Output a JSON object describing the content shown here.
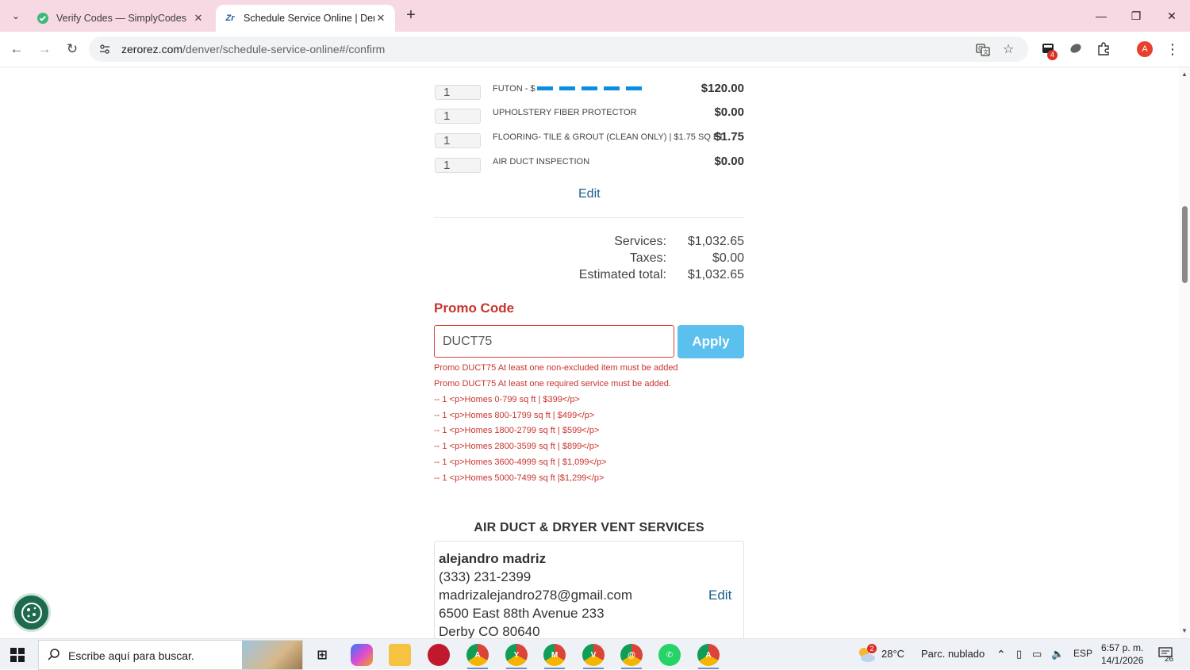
{
  "browser": {
    "tabs": [
      {
        "title": "Verify Codes — SimplyCodes",
        "favicon": "simplycodes-icon"
      },
      {
        "title": "Schedule Service Online | Denver",
        "favicon": "zerorez-icon",
        "favicon_text": "Zr"
      }
    ],
    "url_host": "zerorez.com",
    "url_path": "/denver/schedule-service-online#/confirm",
    "extension_badge": "4",
    "profile_initial": "A"
  },
  "order": {
    "items": [
      {
        "qty": "1",
        "name": "FUTON - $",
        "price": "$120.00"
      },
      {
        "qty": "1",
        "name": "UPHOLSTERY FIBER PROTECTOR",
        "price": "$0.00"
      },
      {
        "qty": "1",
        "name": "FLOORING- TILE & GROUT (CLEAN ONLY) | $1.75 SQ FT",
        "price": "$1.75"
      },
      {
        "qty": "1",
        "name": "AIR DUCT INSPECTION",
        "price": "$0.00"
      }
    ],
    "edit_label": "Edit",
    "summary": [
      {
        "label": "Services:",
        "value": "$1,032.65"
      },
      {
        "label": "Taxes:",
        "value": "$0.00"
      },
      {
        "label": "Estimated total:",
        "value": "$1,032.65"
      }
    ]
  },
  "promo": {
    "title": "Promo Code",
    "value": "DUCT75",
    "apply_label": "Apply",
    "errors": [
      "Promo DUCT75 At least one non-excluded item must be added",
      "Promo DUCT75 At least one required service must be added.",
      "-- 1 <p>Homes 0-799 sq ft | $399</p>",
      "-- 1 <p>Homes 800-1799 sq ft | $499</p>",
      "-- 1 <p>Homes 1800-2799 sq ft | $599</p>",
      "-- 1 <p>Homes 2800-3599 sq ft | $899</p>",
      "-- 1 <p>Homes 3600-4999 sq ft | $1,099</p>",
      "-- 1 <p>Homes 5000-7499 sq ft |$1,299</p>"
    ]
  },
  "contact": {
    "heading": "AIR DUCT & DRYER VENT SERVICES",
    "name": "alejandro madriz",
    "phone": "(333) 231-2399",
    "email": "madrizalejandro278@gmail.com",
    "address1": "6500 East 88th Avenue 233",
    "address2": "Derby CO 80640",
    "edit_label": "Edit"
  },
  "taskbar": {
    "search_placeholder": "Escribe aquí para buscar.",
    "weather_temp": "28°C",
    "weather_desc": "Parc. nublado",
    "weather_badge": "2",
    "language": "ESP",
    "time": "6:57 p. m.",
    "date": "14/1/2026",
    "notifications": "26"
  },
  "colors": {
    "accent_red": "#c9342d",
    "apply_blue": "#5bc0ee",
    "link_blue": "#1a5f8c",
    "tabstrip_pink": "#f7d9e3"
  }
}
